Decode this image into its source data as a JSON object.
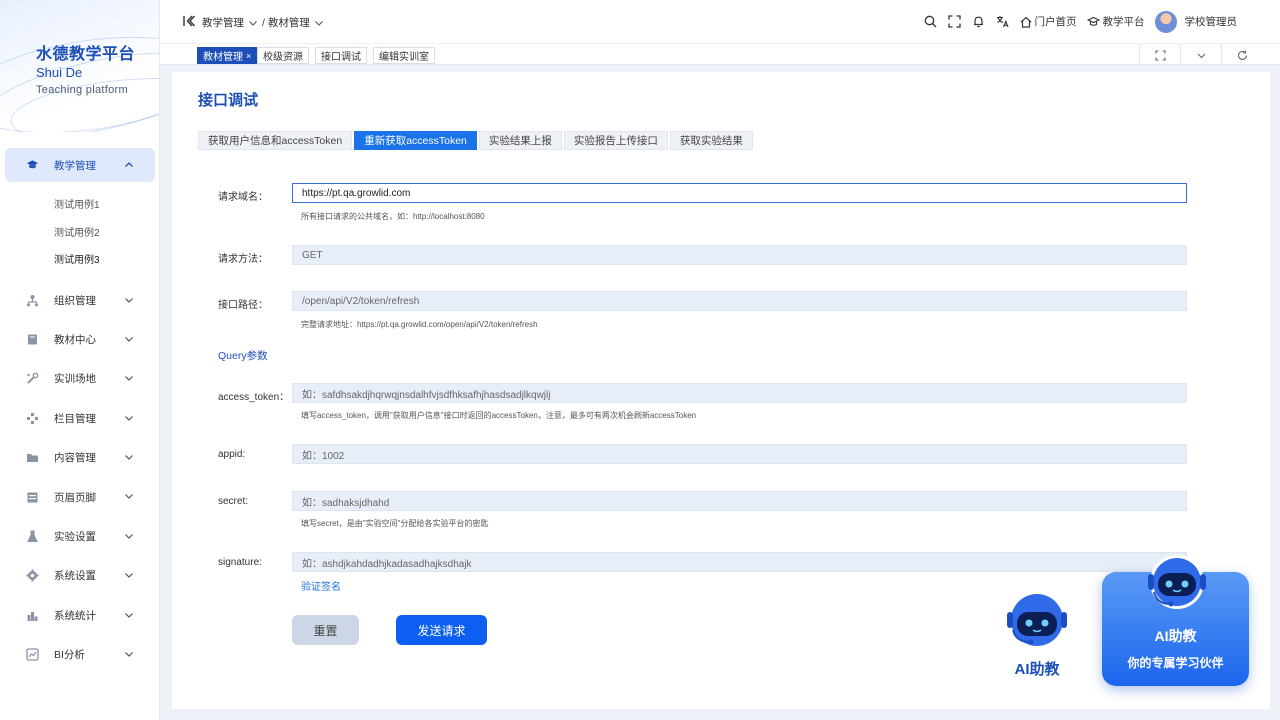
{
  "brand": {
    "title": "水德教学平台",
    "name_en": "Shui De",
    "tagline": "Teaching  platform"
  },
  "sidebar": {
    "items": [
      {
        "label": "教学管理",
        "icon": "graduation-cap-icon",
        "expanded": true
      },
      {
        "label": "组织管理",
        "icon": "org-icon"
      },
      {
        "label": "教材中心",
        "icon": "book-icon"
      },
      {
        "label": "实训场地",
        "icon": "tools-icon"
      },
      {
        "label": "栏目管理",
        "icon": "columns-icon"
      },
      {
        "label": "内容管理",
        "icon": "folder-icon"
      },
      {
        "label": "页眉页脚",
        "icon": "layout-icon"
      },
      {
        "label": "实验设置",
        "icon": "flask-icon"
      },
      {
        "label": "系统设置",
        "icon": "gear-icon"
      },
      {
        "label": "系统统计",
        "icon": "stats-icon"
      },
      {
        "label": "BI分析",
        "icon": "chart-icon"
      }
    ],
    "subitems": [
      "测试用例1",
      "测试用例2",
      "测试用例3"
    ]
  },
  "header": {
    "breadcrumb": [
      "教学管理",
      "/ 教材管理"
    ],
    "links": [
      "门户首页",
      "教学平台"
    ],
    "user": "学校管理员"
  },
  "tabs": [
    {
      "label": "教材管理",
      "close": "×"
    },
    {
      "label": "校级资源"
    },
    {
      "label": "接口调试"
    },
    {
      "label": "编辑实训室"
    }
  ],
  "page": {
    "title": "接口调试",
    "func_tabs": [
      "获取用户信息和accessToken",
      "重新获取accessToken",
      "实验结果上报",
      "实验报告上传接口",
      "获取实验结果"
    ],
    "fields": {
      "domain": {
        "label": "请求域名：",
        "value": "https://pt.qa.growlid.com",
        "hint": "所有接口请求的公共域名，如：http://localhost:8080"
      },
      "method": {
        "label": "请求方法：",
        "value": "GET"
      },
      "path": {
        "label": "接口路径：",
        "value": "/open/api/V2/token/refresh",
        "hint": "完整请求地址：https://pt.qa.growlid.com/open/api/V2/token/refresh"
      },
      "query_title": "Query参数",
      "access_token": {
        "label": "access_token：",
        "value": "如：safdhsakdjhqrwqjnsdalhfvjsdfhksafhjhasdsadjlkqwjlj",
        "hint": "填写access_token，调用\"获取用户信息\"接口时返回的accessToken，注意，最多可有两次机会刷新accessToken"
      },
      "appid": {
        "label": "appid:",
        "value": "如：1002"
      },
      "secret": {
        "label": "secret:",
        "value": "如：sadhaksjdhahd",
        "hint": "填写secret，是由\"实验空间\"分配给各实验平台的密匙"
      },
      "signature": {
        "label": "signature:",
        "value": "如：ashdjkahdadhjkadasadhajksdhajk",
        "link": "验证签名"
      }
    },
    "buttons": {
      "reset": "重置",
      "send": "发送请求"
    }
  },
  "ai": {
    "small_label": "AI助教",
    "card_title": "AI助教",
    "card_sub": "你的专属学习伙伴"
  },
  "colors": {
    "primary": "#1d4fb8",
    "accent": "#1a73e8",
    "field_bg": "#e8eef8"
  }
}
